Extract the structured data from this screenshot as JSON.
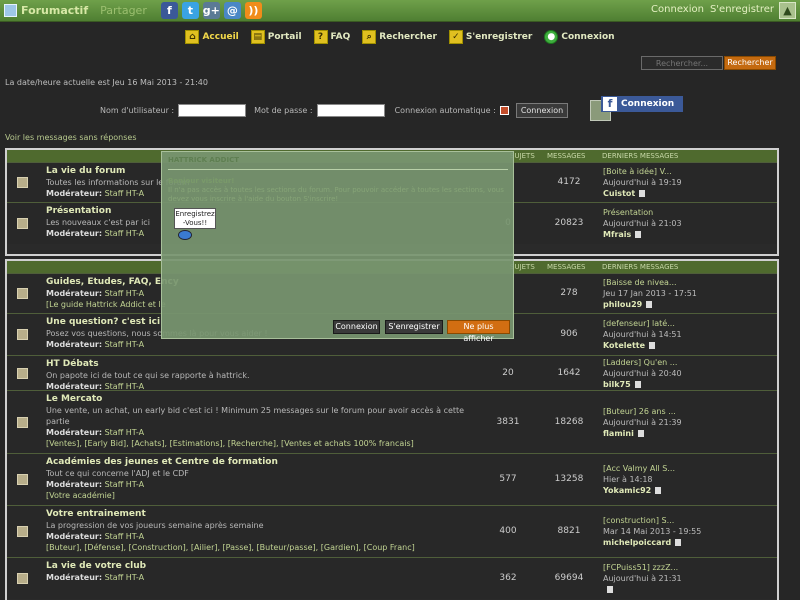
{
  "topbar": {
    "logo": "Forumactif",
    "share": "Partager",
    "social": [
      {
        "name": "facebook-icon",
        "glyph": "f",
        "cls": "s-fb"
      },
      {
        "name": "twitter-icon",
        "glyph": "t",
        "cls": "s-tw"
      },
      {
        "name": "google-plus-icon",
        "glyph": "g+",
        "cls": "s-gp"
      },
      {
        "name": "email-icon",
        "glyph": "@",
        "cls": "s-mail"
      },
      {
        "name": "rss-icon",
        "glyph": "))",
        "cls": "s-rss"
      }
    ],
    "login": "Connexion",
    "register": "S'enregistrer"
  },
  "nav": [
    {
      "label": "Accueil",
      "icon": "home-icon",
      "glyph": "⌂",
      "active": true
    },
    {
      "label": "Portail",
      "icon": "portal-icon",
      "glyph": "▤"
    },
    {
      "label": "FAQ",
      "icon": "faq-icon",
      "glyph": "?"
    },
    {
      "label": "Rechercher",
      "icon": "search-icon",
      "glyph": "⌕"
    },
    {
      "label": "S'enregistrer",
      "icon": "register-icon",
      "glyph": "✓"
    },
    {
      "label": "Connexion",
      "icon": "login-icon",
      "glyph": "●",
      "green": true
    }
  ],
  "search": {
    "placeholder": "Rechercher...",
    "button": "Rechercher"
  },
  "datetime": "La date/heure actuelle est Jeu 16 Mai 2013 - 21:40",
  "login_form": {
    "username_label": "Nom d'utilisateur :",
    "password_label": "Mot de passe :",
    "auto_label": "Connexion automatique :",
    "button": "Connexion",
    "fb_button": "Connexion"
  },
  "unanswered": "Voir les messages sans réponses",
  "headers": {
    "topics": "SUJETS",
    "messages": "MESSAGES",
    "last": "DERNIERS MESSAGES"
  },
  "category1": [
    {
      "title": "La vie du forum",
      "desc": "Toutes les informations sur le forum",
      "mod_label": "Modérateur:",
      "mod": "Staff HT-A",
      "topics": "",
      "messages": "4172",
      "last_title": "[Boite à idée] V...",
      "last_time": "Aujourd'hui à 19:19",
      "last_user": "Cuistot"
    },
    {
      "title": "Présentation",
      "desc": "Les nouveaux c'est par ici",
      "mod_label": "Modérateur:",
      "mod": "Staff HT-A",
      "topics": "0",
      "messages": "20823",
      "last_title": "Présentation",
      "last_time": "Aujourd'hui à 21:03",
      "last_user": "Mfrais"
    }
  ],
  "category2": [
    {
      "title": "Guides, Etudes, FAQ, Ency",
      "desc": "",
      "mod_label": "Modérateur:",
      "mod": "Staff HT-A",
      "links": "[Le guide Hattrick Addict et le",
      "topics": "",
      "messages": "278",
      "last_title": "[Baisse de nivea...",
      "last_time": "Jeu 17 Jan 2013 - 17:51",
      "last_user": "philou29"
    },
    {
      "title": "Une question? c'est ici",
      "desc": "Posez vos questions, nous sommes là pour vous aider !",
      "mod_label": "Modérateur:",
      "mod": "Staff HT-A",
      "links": "",
      "topics": "",
      "messages": "906",
      "last_title": "[defenseur] laté...",
      "last_time": "Aujourd'hui à 14:51",
      "last_user": "Kotelette"
    },
    {
      "title": "HT Débats",
      "desc": "On papote ici de tout ce qui se rapporte à hattrick.",
      "mod_label": "Modérateur:",
      "mod": "Staff HT-A",
      "links": "",
      "topics": "20",
      "messages": "1642",
      "last_title": "[Ladders] Qu'en ...",
      "last_time": "Aujourd'hui à 20:40",
      "last_user": "bilk75"
    },
    {
      "title": "Le Mercato",
      "desc": "Une vente, un achat, un early bid c'est ici ! Minimum 25 messages sur le forum pour avoir accès à cette",
      "desc2": "partie",
      "mod_label": "Modérateur:",
      "mod": "Staff HT-A",
      "links": "[Ventes], [Early Bid], [Achats], [Estimations], [Recherche], [Ventes et achats 100% francais]",
      "topics": "3831",
      "messages": "18268",
      "last_title": "[Buteur] 26 ans ...",
      "last_time": "Aujourd'hui à 21:39",
      "last_user": "flamini"
    },
    {
      "title": "Académies des jeunes et Centre de formation",
      "desc": "Tout ce qui concerne l'ADJ et le CDF",
      "mod_label": "Modérateur:",
      "mod": "Staff HT-A",
      "links": "[Votre académie]",
      "topics": "577",
      "messages": "13258",
      "last_title": "[Acc Valmy All S...",
      "last_time": "Hier à 14:18",
      "last_user": "Yokamic92"
    },
    {
      "title": "Votre entrainement",
      "desc": "La progression de vos joueurs semaine après semaine",
      "mod_label": "Modérateur:",
      "mod": "Staff HT-A",
      "links": "[Buteur], [Défense], [Construction], [Ailier], [Passe], [Buteur/passe], [Gardien], [Coup Franc]",
      "topics": "400",
      "messages": "8821",
      "last_title": "[construction] S...",
      "last_time": "Mar 14 Mai 2013 - 19:55",
      "last_user": "michelpoiccard"
    },
    {
      "title": "La vie de votre club",
      "desc": "",
      "mod_label": "Modérateur:",
      "mod": "Staff HT-A",
      "links": "",
      "topics": "362",
      "messages": "69694",
      "last_title": "[FCPuiss51] zzzZ...",
      "last_time": "Aujourd'hui à 21:31",
      "last_user": ""
    }
  ],
  "popup": {
    "title": "HATTRICK ADDICT",
    "subtitle": "Bonjour visiteur!",
    "text": "Il n'a pas accès à toutes les sections du forum. Pour pouvoir accéder à toutes les sections, vous devez vous inscrire à l'aide du bouton S'inscrire!",
    "sign_line1": "Enregistrez",
    "sign_line2": "-Vous!!",
    "btn_login": "Connexion",
    "btn_register": "S'enregistrer",
    "btn_hide": "Ne plus afficher"
  }
}
